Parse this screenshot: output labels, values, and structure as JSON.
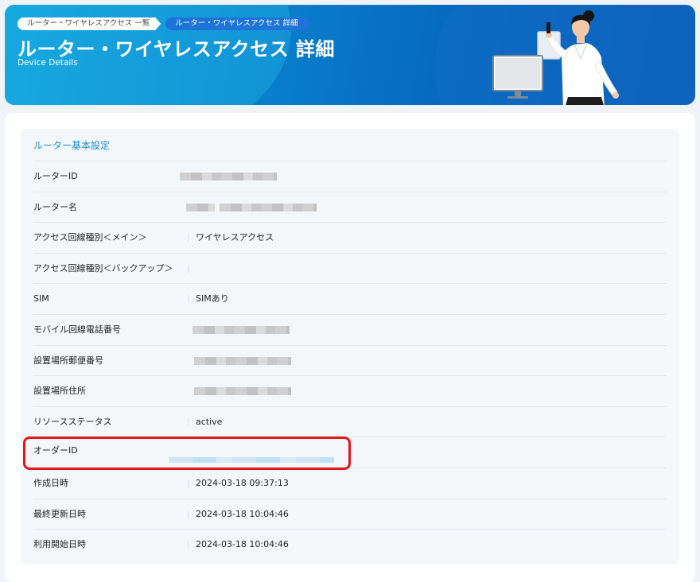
{
  "header": {
    "breadcrumb": [
      "ルーター・ワイヤレスアクセス 一覧",
      "ルーター・ワイヤレスアクセス 詳細"
    ],
    "title": "ルーター・ワイヤレスアクセス 詳細",
    "subtitle": "Device Details"
  },
  "colors": {
    "banner_start": "#0c9fd8",
    "banner_end": "#0a59b3",
    "section_title": "#1f8bd0",
    "highlight": "#e01818"
  },
  "section": {
    "title": "ルーター基本設定",
    "rows": [
      {
        "label": "ルーターID",
        "value": "",
        "redacted": true
      },
      {
        "label": "ルーター名",
        "value": "",
        "redacted": true
      },
      {
        "label": "アクセス回線種別＜メイン＞",
        "value": "ワイヤレスアクセス"
      },
      {
        "label": "アクセス回線種別＜バックアップ＞",
        "value": ""
      },
      {
        "label": "SIM",
        "value": "SIMあり"
      },
      {
        "label": "モバイル回線電話番号",
        "value": "",
        "redacted": true
      },
      {
        "label": "設置場所郵便番号",
        "value": "",
        "redacted": true
      },
      {
        "label": "設置場所住所",
        "value": "",
        "redacted": true
      },
      {
        "label": "リソースステータス",
        "value": "active"
      },
      {
        "label": "オーダーID",
        "value": "",
        "redacted": true,
        "highlighted": true
      },
      {
        "label": "作成日時",
        "value": "2024-03-18 09:37:13"
      },
      {
        "label": "最終更新日時",
        "value": "2024-03-18 10:04:46"
      },
      {
        "label": "利用開始日時",
        "value": "2024-03-18 10:04:46"
      }
    ]
  }
}
